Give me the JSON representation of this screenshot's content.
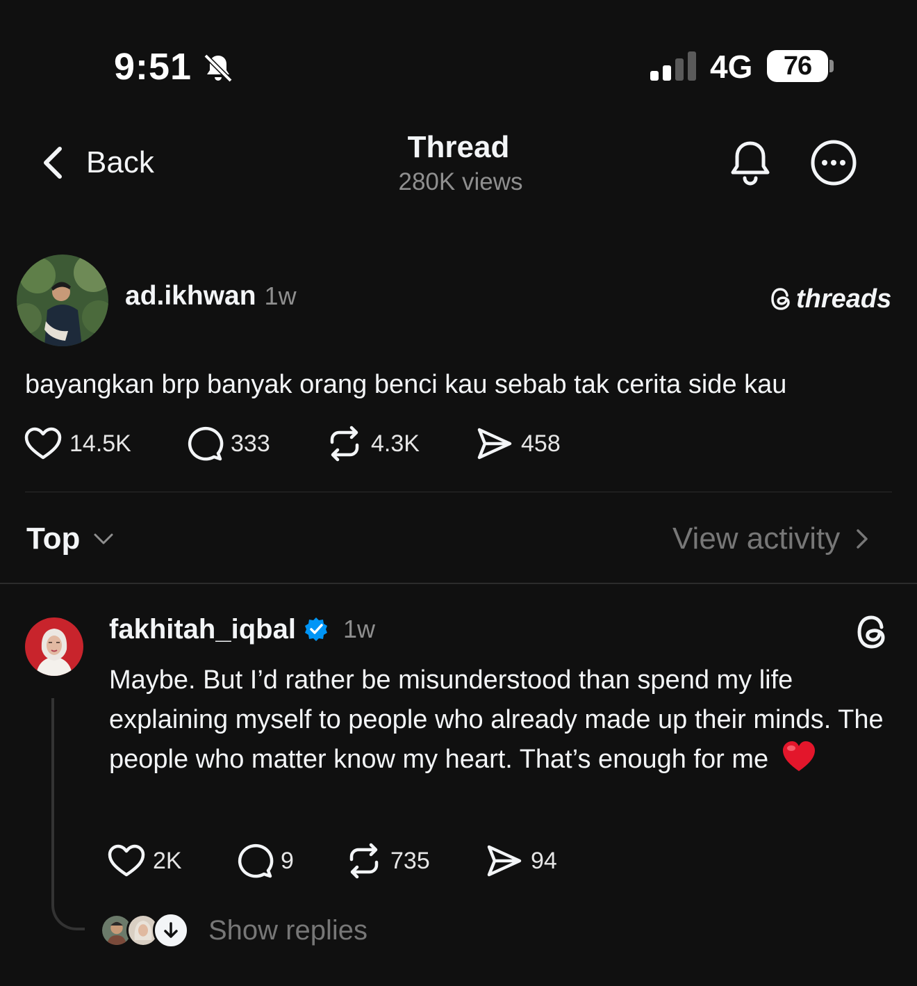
{
  "status_bar": {
    "time": "9:51",
    "network": "4G",
    "battery": "76",
    "icons": [
      "bell-muted-icon",
      "signal-icon",
      "battery-icon"
    ]
  },
  "header": {
    "back_label": "Back",
    "title": "Thread",
    "views": "280K views",
    "icons": [
      "chevron-left-icon",
      "bell-icon",
      "more-icon"
    ]
  },
  "post": {
    "username": "ad.ikhwan",
    "time": "1w",
    "watermark": "threads",
    "text": "bayangkan brp banyak orang benci kau sebab tak cerita side kau",
    "likes": "14.5K",
    "replies": "333",
    "reposts": "4.3K",
    "shares": "458"
  },
  "sort": {
    "label": "Top",
    "view_activity": "View activity"
  },
  "reply": {
    "username": "fakhitah_iqbal",
    "time": "1w",
    "verified": true,
    "text": "Maybe. But I’d rather be misunderstood than spend my life explaining myself to people who already made up their minds. The people who matter know my heart. That’s enough for me",
    "emoji": "red-heart",
    "likes": "2K",
    "replies": "9",
    "reposts": "735",
    "shares": "94",
    "show_replies": "Show replies"
  },
  "colors": {
    "background": "#101010",
    "text": "#f3f5f7",
    "muted": "#8f8f8f",
    "verified": "#0095f6",
    "heart": "#e3162b"
  }
}
